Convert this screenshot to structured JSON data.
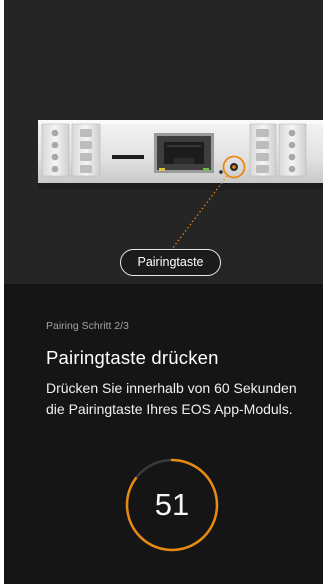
{
  "hero": {
    "button_label": "Pairingtaste"
  },
  "content": {
    "step": "Pairing Schritt 2/3",
    "title": "Pairingtaste drücken",
    "description": "Drücken Sie innerhalb von 60 Sekunden die Pairingtaste Ihres EOS App-Moduls."
  },
  "timer": {
    "seconds_remaining": "51",
    "total_seconds": 60,
    "ring_color": "#e88a12",
    "track_color": "#3a3a3a"
  },
  "colors": {
    "background": "#151515",
    "hero_background": "#252525",
    "accent": "#e88a12"
  }
}
